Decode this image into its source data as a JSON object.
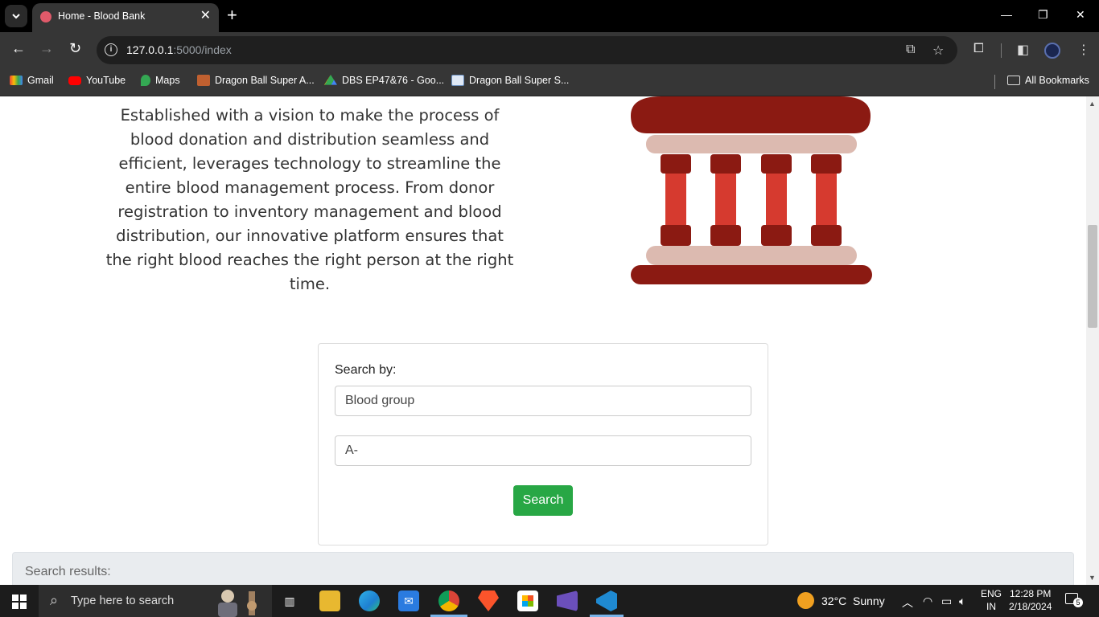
{
  "browser": {
    "tab_title": "Home - Blood Bank",
    "url_host": "127.0.0.1",
    "url_rest": ":5000/index",
    "bookmarks": [
      "Gmail",
      "YouTube",
      "Maps",
      "Dragon Ball Super A...",
      "DBS EP47&76 - Goo...",
      "Dragon Ball Super S..."
    ],
    "all_bookmarks": "All Bookmarks"
  },
  "page": {
    "about_text": "Established with a vision to make the process of blood donation and distribution seamless and efficient, leverages technology to streamline the entire blood management process. From donor registration to inventory management and blood distribution, our innovative platform ensures that the right blood reaches the right person at the right time.",
    "search": {
      "label": "Search by:",
      "criteria_value": "Blood group",
      "value": "A-",
      "button": "Search"
    },
    "results_label": "Search results:"
  },
  "taskbar": {
    "search_placeholder": "Type here to search",
    "weather_temp": "32°C",
    "weather_desc": "Sunny",
    "lang_line1": "ENG",
    "lang_line2": "IN",
    "time": "12:28 PM",
    "date": "2/18/2024",
    "notifications": "5"
  },
  "colors": {
    "accent_green": "#28a745",
    "pillar_dark": "#8b1a12",
    "pillar_red": "#d63a2f",
    "pillar_light": "#dcbab0"
  }
}
